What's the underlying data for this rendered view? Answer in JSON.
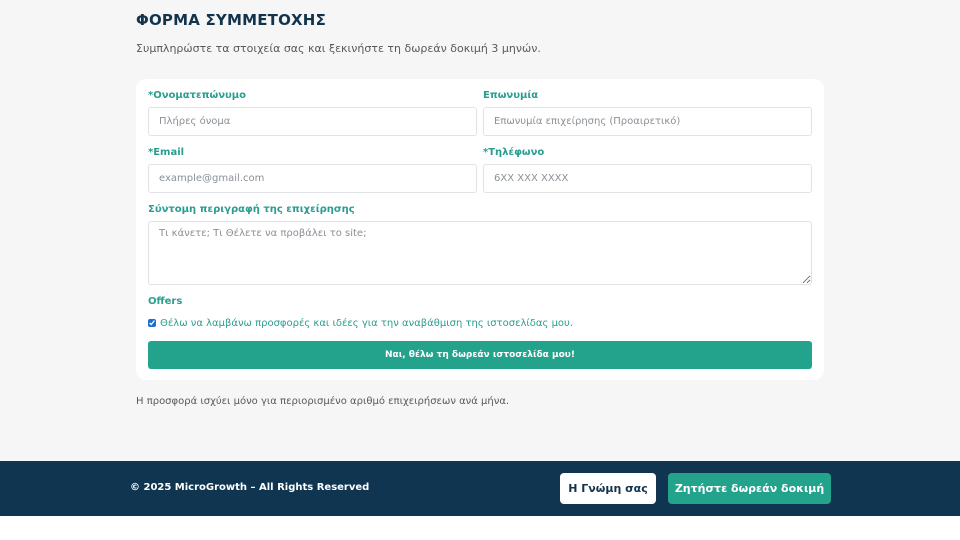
{
  "page": {
    "title": "ΦΟΡΜΑ ΣΥΜΜΕΤΟΧΗΣ",
    "subtitle": "Συμπληρώστε τα στοιχεία σας και ξεκινήστε τη δωρεάν δοκιμή 3 μηνών."
  },
  "form": {
    "fullname": {
      "label": "*Ονοματεπώνυμο",
      "placeholder": "Πλήρες όνομα",
      "value": ""
    },
    "company": {
      "label": "Επωνυμία",
      "placeholder": "Επωνυμία επιχείρησης (Προαιρετικό)",
      "value": ""
    },
    "email": {
      "label": "*Email",
      "placeholder": "example@gmail.com",
      "value": ""
    },
    "phone": {
      "label": "*Τηλέφωνο",
      "placeholder": "6XX XXX XXXX",
      "value": ""
    },
    "description": {
      "label": "Σύντομη περιγραφή της επιχείρησης",
      "placeholder": "Τι κάνετε; Τι Θέλετε να προβάλει το site;",
      "value": ""
    },
    "offers": {
      "label": "Offers",
      "checkbox_label": "Θέλω να λαμβάνω προσφορές και ιδέες για την αναβάθμιση της ιστοσελίδας μου.",
      "checked": true
    },
    "submit_label": "Ναι, θέλω τη δωρεάν ιστοσελίδα μου!"
  },
  "note": "Η προσφορά ισχύει μόνο για περιορισμένο αριθμό επιχειρήσεων ανά μήνα.",
  "footer": {
    "copyright": "© 2025 MicroGrowth – All Rights Reserved",
    "opinion_button": "Η Γνώμη σας",
    "trial_button": "Ζητήστε δωρεάν δοκιμή"
  },
  "colors": {
    "accent": "#24a38c",
    "heading": "#12344d",
    "footer_bg": "#0f3550",
    "label": "#2a9d8f"
  }
}
